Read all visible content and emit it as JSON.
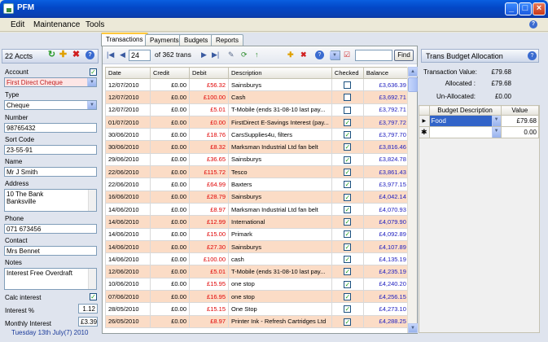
{
  "window": {
    "title": "PFM"
  },
  "menu": [
    "Edit",
    "Maintenance",
    "Tools"
  ],
  "left": {
    "accounts_count": "22 Accts",
    "account_label": "Account",
    "account_value": "First Direct Cheque",
    "type_label": "Type",
    "type_value": "Cheque",
    "number_label": "Number",
    "number_value": "98765432",
    "sortcode_label": "Sort Code",
    "sortcode_value": "23-55-91",
    "name_label": "Name",
    "name_value": "Mr J Smith",
    "address_label": "Address",
    "address_line1": "10 The Bank",
    "address_line2": "Banksville",
    "phone_label": "Phone",
    "phone_value": "071 673456",
    "contact_label": "Contact",
    "contact_value": "Mrs Bennet",
    "notes_label": "Notes",
    "notes_value": "Interest Free Overdraft",
    "calc_interest_label": "Calc interest",
    "interest_pct_label": "Interest %",
    "interest_pct_value": "1.12",
    "monthly_interest_label": "Monthly Interest",
    "monthly_interest_value": "£3.39"
  },
  "tabs": [
    "Transactions",
    "Payments",
    "Budgets",
    "Reports"
  ],
  "toolbar": {
    "record": "24",
    "of_label": "of 362 trans",
    "find_label": "Find"
  },
  "grid": {
    "columns": [
      "Date",
      "Credit",
      "Debit",
      "Description",
      "Checked",
      "Balance"
    ],
    "rows": [
      {
        "date": "12/07/2010",
        "credit": "£0.00",
        "debit": "£56.32",
        "desc": "Sainsburys",
        "checked": false,
        "balance": "£3,636.39"
      },
      {
        "date": "12/07/2010",
        "credit": "£0.00",
        "debit": "£100.00",
        "desc": "Cash",
        "checked": false,
        "balance": "£3,692.71"
      },
      {
        "date": "12/07/2010",
        "credit": "£0.00",
        "debit": "£5.01",
        "desc": "T-Mobile  (ends 31-08-10 last pay...",
        "checked": false,
        "balance": "£3,792.71"
      },
      {
        "date": "01/07/2010",
        "credit": "£0.00",
        "debit": "£0.00",
        "desc": "FirstDirect E-Savings Interest (pay...",
        "checked": true,
        "balance": "£3,797.72"
      },
      {
        "date": "30/06/2010",
        "credit": "£0.00",
        "debit": "£18.76",
        "desc": "CarsSupplies4u, filters",
        "checked": true,
        "balance": "£3,797.70"
      },
      {
        "date": "30/06/2010",
        "credit": "£0.00",
        "debit": "£8.32",
        "desc": "Marksman Industrial Ltd fan belt",
        "checked": true,
        "balance": "£3,816.46"
      },
      {
        "date": "29/06/2010",
        "credit": "£0.00",
        "debit": "£36.65",
        "desc": "Sainsburys",
        "checked": true,
        "balance": "£3,824.78"
      },
      {
        "date": "22/06/2010",
        "credit": "£0.00",
        "debit": "£115.72",
        "desc": "Tesco",
        "checked": true,
        "balance": "£3,861.43"
      },
      {
        "date": "22/06/2010",
        "credit": "£0.00",
        "debit": "£64.99",
        "desc": "Baxters",
        "checked": true,
        "balance": "£3,977.15"
      },
      {
        "date": "16/06/2010",
        "credit": "£0.00",
        "debit": "£28.79",
        "desc": "Sainsburys",
        "checked": true,
        "balance": "£4,042.14"
      },
      {
        "date": "14/06/2010",
        "credit": "£0.00",
        "debit": "£8.97",
        "desc": "Marksman Industrial Ltd fan belt",
        "checked": true,
        "balance": "£4,070.93"
      },
      {
        "date": "14/06/2010",
        "credit": "£0.00",
        "debit": "£12.99",
        "desc": "International",
        "checked": true,
        "balance": "£4,079.90"
      },
      {
        "date": "14/06/2010",
        "credit": "£0.00",
        "debit": "£15.00",
        "desc": "Primark",
        "checked": true,
        "balance": "£4,092.89"
      },
      {
        "date": "14/06/2010",
        "credit": "£0.00",
        "debit": "£27.30",
        "desc": "Sainsburys",
        "checked": true,
        "balance": "£4,107.89"
      },
      {
        "date": "14/06/2010",
        "credit": "£0.00",
        "debit": "£100.00",
        "desc": "cash",
        "checked": true,
        "balance": "£4,135.19"
      },
      {
        "date": "12/06/2010",
        "credit": "£0.00",
        "debit": "£5.01",
        "desc": "T-Mobile  (ends 31-08-10 last pay...",
        "checked": true,
        "balance": "£4,235.19"
      },
      {
        "date": "10/06/2010",
        "credit": "£0.00",
        "debit": "£15.95",
        "desc": "one stop",
        "checked": true,
        "balance": "£4,240.20"
      },
      {
        "date": "07/06/2010",
        "credit": "£0.00",
        "debit": "£16.95",
        "desc": "one stop",
        "checked": true,
        "balance": "£4,256.15"
      },
      {
        "date": "28/05/2010",
        "credit": "£0.00",
        "debit": "£15.15",
        "desc": "One Stop",
        "checked": true,
        "balance": "£4,273.10"
      },
      {
        "date": "26/05/2010",
        "credit": "£0.00",
        "debit": "£8.97",
        "desc": "Printer Ink - Refresh Cartridges Ltd",
        "checked": true,
        "balance": "£4,288.25"
      }
    ]
  },
  "right": {
    "title": "Trans Budget Allocation",
    "trans_value_label": "Transaction Value:",
    "trans_value": "£79.68",
    "allocated_label": "Allocated :",
    "allocated_value": "£79.68",
    "unallocated_label": "Un-Allocated:",
    "unallocated_value": "£0.00",
    "budget_columns": [
      "Budget Description",
      "Value"
    ],
    "budget_rows": [
      {
        "desc": "Food",
        "value": "£79.68"
      },
      {
        "desc": "",
        "value": "0.00"
      }
    ]
  },
  "status": "Tuesday 13th July(7) 2010",
  "colors": {
    "title_bar": "#0348c8",
    "odd_row": "#fbdcc6",
    "debit": "#e00000",
    "balance": "#2020c0",
    "selected_row": "#3264c8"
  }
}
